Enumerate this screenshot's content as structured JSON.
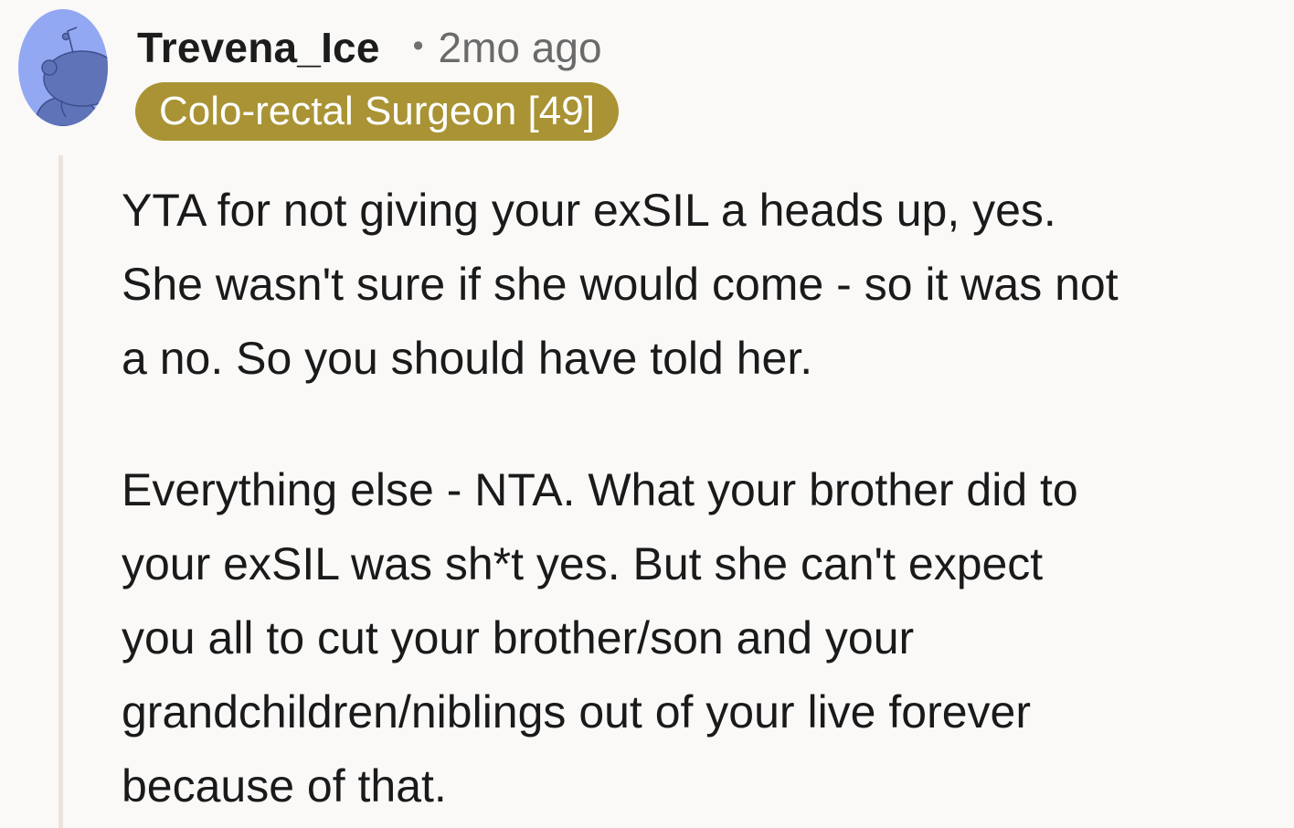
{
  "comment": {
    "author": "Trevena_Ice",
    "separator": "•",
    "timestamp": "2mo ago",
    "flair": "Colo-rectal Surgeon [49]",
    "avatar_icon": "snoo-avatar-icon",
    "paragraphs": [
      "YTA for not giving your exSIL a heads up, yes.\nShe wasn't sure if she would come - so it was not\na no. So you should have told her.",
      "Everything else - NTA. What your brother did to\nyour exSIL was sh*t yes. But she can't expect\nyou all to cut your brother/son and your\ngrandchildren/niblings out of your live forever\nbecause of that."
    ]
  },
  "colors": {
    "background": "#faf9f7",
    "flair_background": "#a99334",
    "avatar_blue": "#93a8f2",
    "avatar_dark": "#5f73b8",
    "thread_line": "#ebe3dc"
  }
}
